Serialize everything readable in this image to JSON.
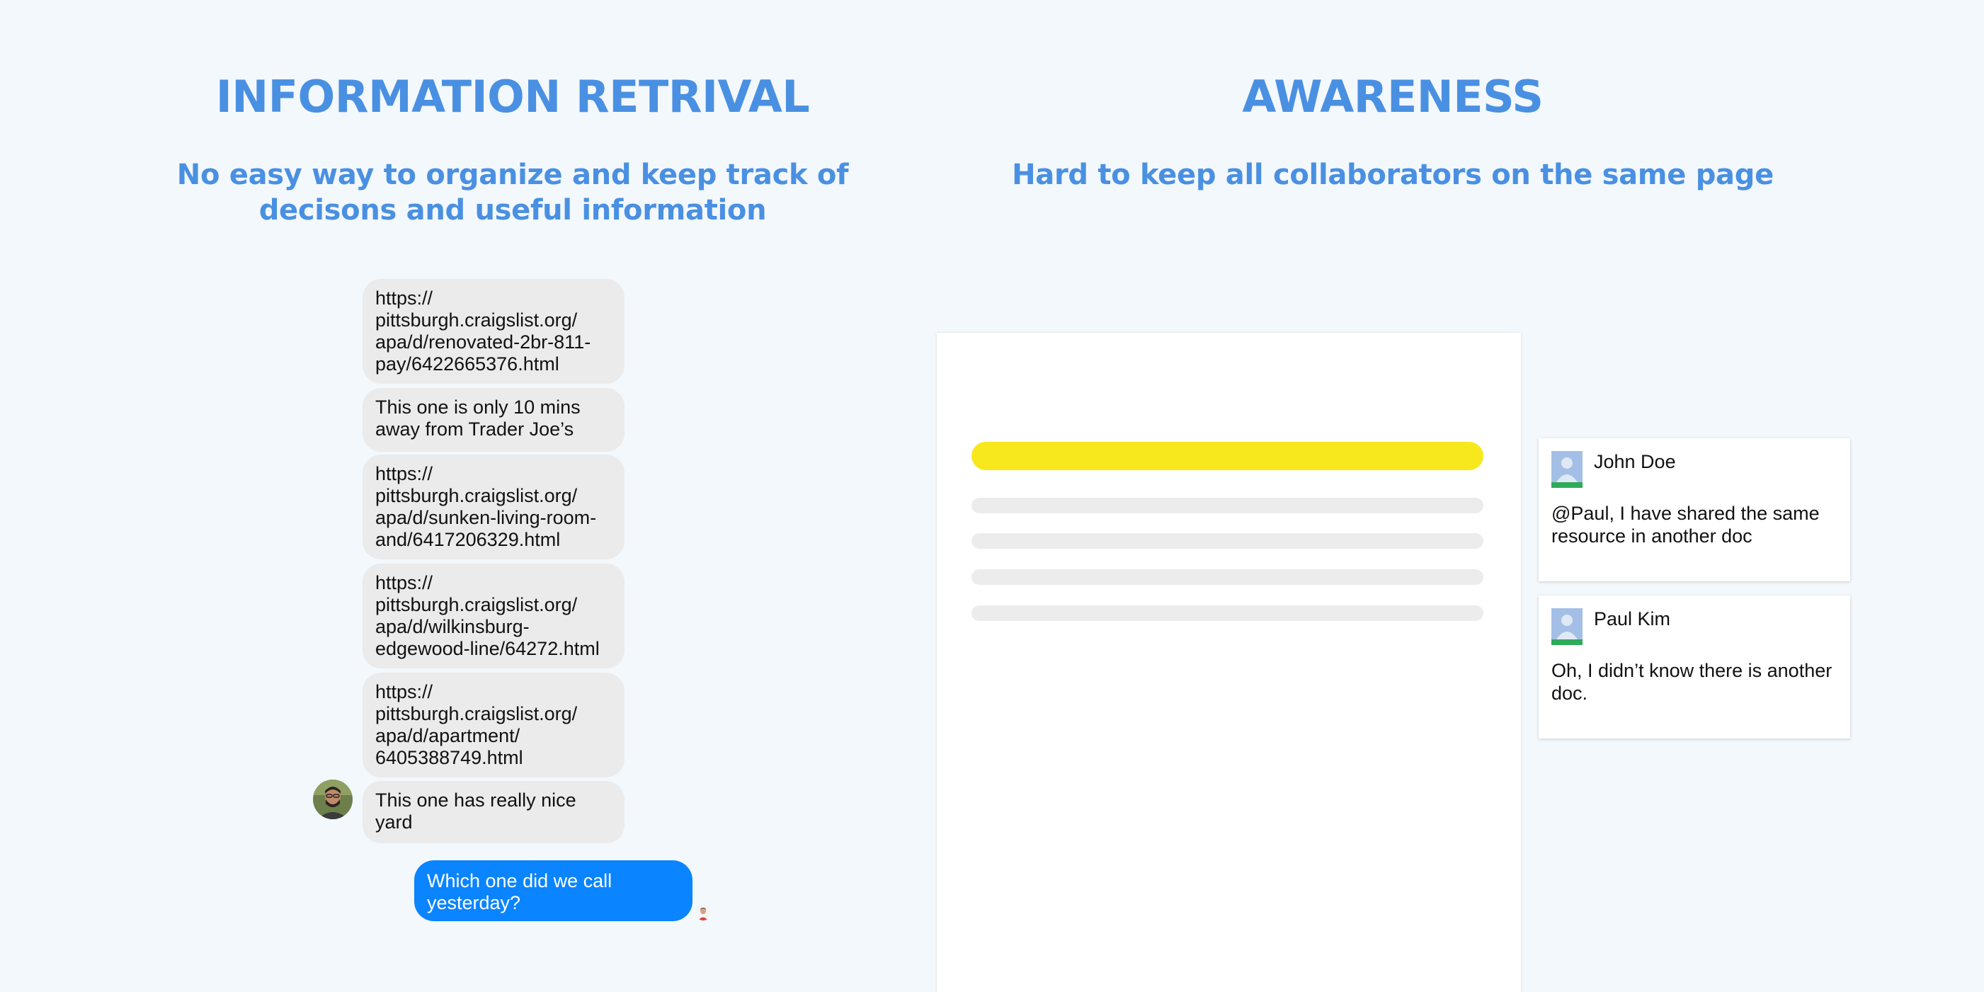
{
  "left": {
    "title": "INFORMATION RETRIVAL",
    "subtitle_line1": "No easy way to organize and keep track of",
    "subtitle_line2": "decisons and useful information"
  },
  "right": {
    "title": "AWARENESS",
    "subtitle": "Hard to keep all collaborators on the same page"
  },
  "chat": {
    "received": [
      {
        "lines": [
          "https://",
          "pittsburgh.craigslist.org/",
          "apa/d/renovated-2br-811-",
          "pay/6422665376.html"
        ]
      },
      {
        "lines": [
          "This one is only 10 mins",
          "away from Trader Joe’s"
        ]
      },
      {
        "lines": [
          "https://",
          "pittsburgh.craigslist.org/",
          "apa/d/sunken-living-room-",
          "and/6417206329.html"
        ]
      },
      {
        "lines": [
          "https://",
          "pittsburgh.craigslist.org/",
          "apa/d/wilkinsburg-",
          "edgewood-line/64272.html"
        ]
      },
      {
        "lines": [
          "https://",
          "pittsburgh.craigslist.org/",
          "apa/d/apartment/",
          "6405388749.html"
        ]
      },
      {
        "lines": [
          "This one has really nice",
          "yard"
        ]
      }
    ],
    "sent": {
      "lines": [
        "Which one did we call",
        "yesterday?"
      ]
    },
    "colors": {
      "received_bubble": "#ebebeb",
      "sent_bubble": "#0a84ff"
    }
  },
  "doc": {
    "highlight_color": "#f7e81e",
    "line_color": "#ececec"
  },
  "comments": [
    {
      "name": "John Doe",
      "text_line1": "@Paul, I have shared the same",
      "text_line2": "resource in another doc"
    },
    {
      "name": "Paul Kim",
      "text_line1": "Oh, I didn’t know there is another",
      "text_line2": "doc."
    }
  ],
  "accent_color": "#4a90e2"
}
